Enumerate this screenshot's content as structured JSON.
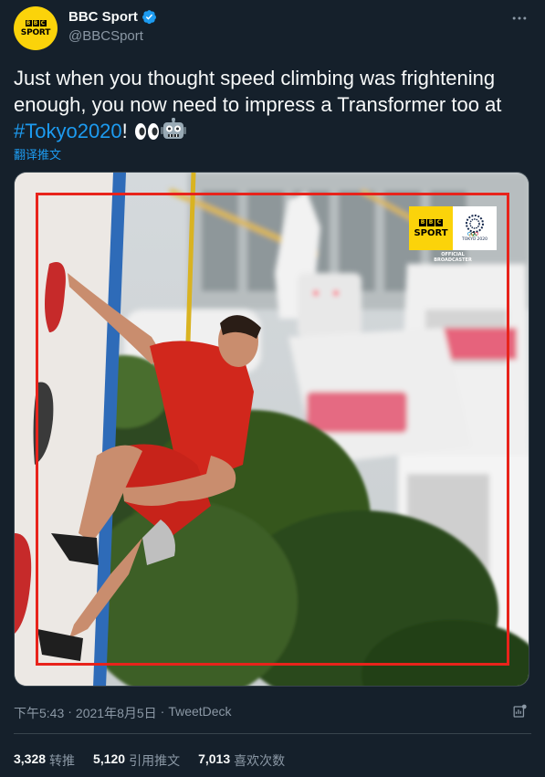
{
  "author": {
    "display_name": "BBC Sport",
    "handle": "@BBCSport",
    "avatar_letters": [
      "B",
      "B",
      "C"
    ],
    "avatar_word": "SPORT",
    "verified": true
  },
  "tweet": {
    "text_part1": "Just when you thought speed climbing was frightening enough, you now need to impress a Transformer too at ",
    "hashtag": "#Tokyo2020",
    "text_part2": "! ",
    "translate_label": "翻译推文"
  },
  "media": {
    "logo_bbc_letters": [
      "B",
      "B",
      "C"
    ],
    "logo_bbc_word": "SPORT",
    "logo_olympic_text": "TOKYO 2020",
    "broadcaster_line1": "OFFICIAL",
    "broadcaster_line2": "BROADCASTER"
  },
  "meta": {
    "time": "下午5:43",
    "dot1": "·",
    "date": "2021年8月5日",
    "dot2": "·",
    "source": "TweetDeck"
  },
  "stats": [
    {
      "num": "3,328",
      "label": "转推"
    },
    {
      "num": "5,120",
      "label": "引用推文"
    },
    {
      "num": "7,013",
      "label": "喜欢次数"
    }
  ],
  "colors": {
    "background": "#15202b",
    "accent": "#1d9bf0",
    "bbc_yellow": "#fbd30a",
    "frame_red": "#e8231b"
  }
}
